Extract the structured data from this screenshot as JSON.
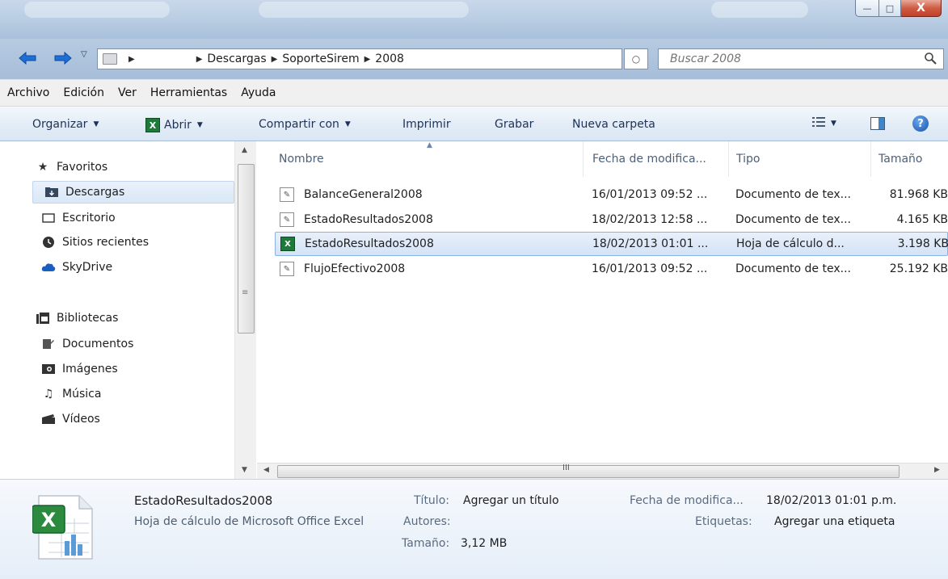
{
  "window": {
    "controls": {
      "minimize": "—",
      "maximize": "□",
      "close": "X"
    }
  },
  "address": {
    "crumbs": [
      "Descargas",
      "SoporteSirem",
      "2008"
    ],
    "search_placeholder": "Buscar 2008"
  },
  "menu": [
    "Archivo",
    "Edición",
    "Ver",
    "Herramientas",
    "Ayuda"
  ],
  "commands": {
    "organize": "Organizar",
    "open": "Abrir",
    "share": "Compartir con",
    "print": "Imprimir",
    "burn": "Grabar",
    "new_folder": "Nueva carpeta"
  },
  "nav": {
    "favorites_label": "Favoritos",
    "favorites": [
      "Descargas",
      "Escritorio",
      "Sitios recientes",
      "SkyDrive"
    ],
    "libraries_label": "Bibliotecas",
    "libraries": [
      "Documentos",
      "Imágenes",
      "Música",
      "Vídeos"
    ]
  },
  "columns": {
    "name": "Nombre",
    "date": "Fecha de modifica...",
    "type": "Tipo",
    "size": "Tamaño"
  },
  "files": [
    {
      "name": "BalanceGeneral2008",
      "date": "16/01/2013 09:52 ...",
      "type": "Documento de tex...",
      "size": "81.968 KB",
      "icon": "text-document-icon"
    },
    {
      "name": "EstadoResultados2008",
      "date": "18/02/2013 12:58 ...",
      "type": "Documento de tex...",
      "size": "4.165 KB",
      "icon": "text-document-icon"
    },
    {
      "name": "EstadoResultados2008",
      "date": "18/02/2013 01:01 ...",
      "type": "Hoja de cálculo d...",
      "size": "3.198 KB",
      "icon": "excel-icon",
      "selected": true
    },
    {
      "name": "FlujoEfectivo2008",
      "date": "16/01/2013 09:52 ...",
      "type": "Documento de tex...",
      "size": "25.192 KB",
      "icon": "text-document-icon"
    }
  ],
  "details": {
    "name": "EstadoResultados2008",
    "type": "Hoja de cálculo de Microsoft Office Excel",
    "title_label": "Título:",
    "title_value": "Agregar un título",
    "authors_label": "Autores:",
    "size_label": "Tamaño:",
    "size_value": "3,12 MB",
    "date_label": "Fecha de modifica...",
    "date_value": "18/02/2013 01:01 p.m.",
    "tags_label": "Etiquetas:",
    "tags_value": "Agregar una etiqueta"
  },
  "colors": {
    "accent": "#1e3257",
    "selection": "#d4e3f6",
    "excel_green": "#1e7a3a"
  }
}
